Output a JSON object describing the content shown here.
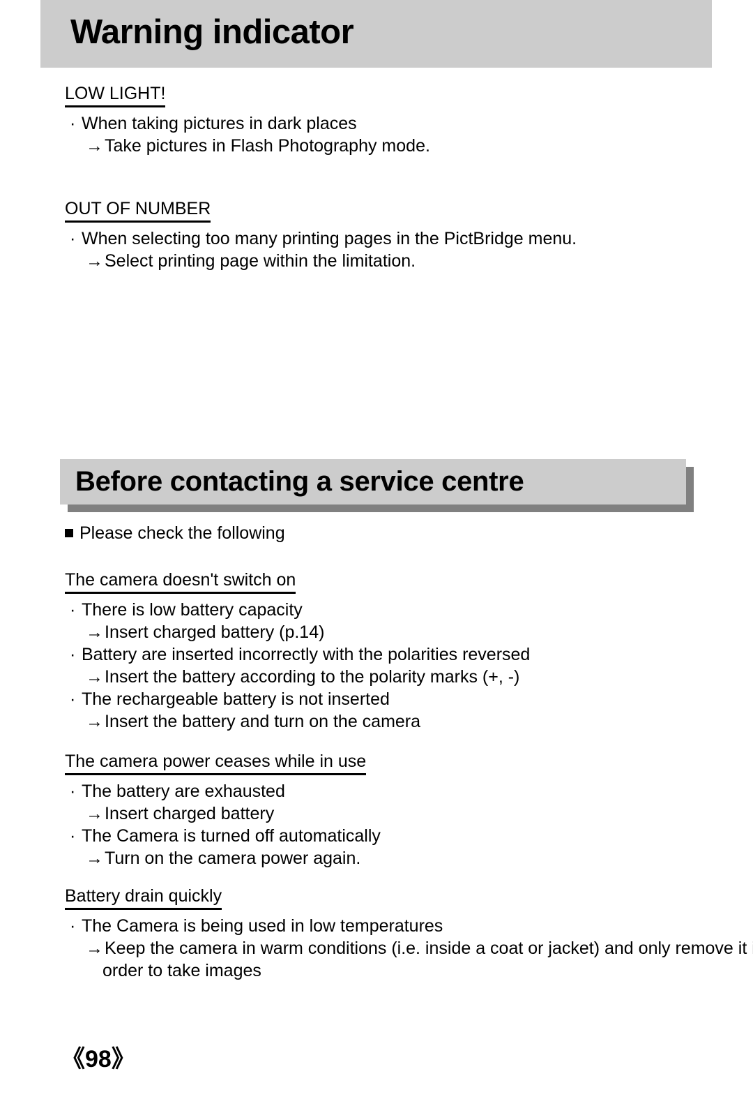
{
  "page": {
    "number_label": "《98》"
  },
  "header_primary": {
    "title": "Warning indicator"
  },
  "header_secondary": {
    "title": "Before contacting a service centre"
  },
  "warning_sections": [
    {
      "heading": "LOW LIGHT!",
      "items": [
        {
          "bullet": "·",
          "text": "When taking pictures in dark places"
        },
        {
          "arrow": "→",
          "text": "Take pictures in Flash Photography mode."
        }
      ]
    },
    {
      "heading": "OUT OF NUMBER",
      "items": [
        {
          "bullet": "·",
          "text": "When selecting too many printing pages in the PictBridge menu."
        },
        {
          "arrow": "→",
          "text": "Select printing page within the limitation."
        }
      ]
    }
  ],
  "service": {
    "intro": "Please check the following",
    "sections": [
      {
        "heading": "The camera doesn't switch on",
        "items": [
          {
            "bullet": "·",
            "text": "There is low battery capacity"
          },
          {
            "arrow": "→",
            "text": "Insert charged battery (p.14)"
          },
          {
            "bullet": "·",
            "text": "Battery are inserted incorrectly with the polarities reversed"
          },
          {
            "arrow": "→",
            "text": "Insert the battery according to the polarity marks (+, -)"
          },
          {
            "bullet": "·",
            "text": "The rechargeable battery is not inserted"
          },
          {
            "arrow": "→",
            "text": "Insert the battery and turn on the camera"
          }
        ]
      },
      {
        "heading": "The camera power ceases while in use",
        "items": [
          {
            "bullet": "·",
            "text": "The battery are exhausted"
          },
          {
            "arrow": "→",
            "text": "Insert charged battery"
          },
          {
            "bullet": "·",
            "text": "The Camera is turned off automatically"
          },
          {
            "arrow": "→",
            "text": "Turn on the camera power again."
          }
        ]
      },
      {
        "heading": "Battery drain quickly",
        "items": [
          {
            "bullet": "·",
            "text": "The Camera is being used in low temperatures"
          },
          {
            "arrow": "→",
            "text": "Keep the camera in warm conditions (i.e. inside a coat or jacket) and only remove it in"
          },
          {
            "cont": true,
            "text": "order to take images"
          }
        ]
      }
    ]
  }
}
